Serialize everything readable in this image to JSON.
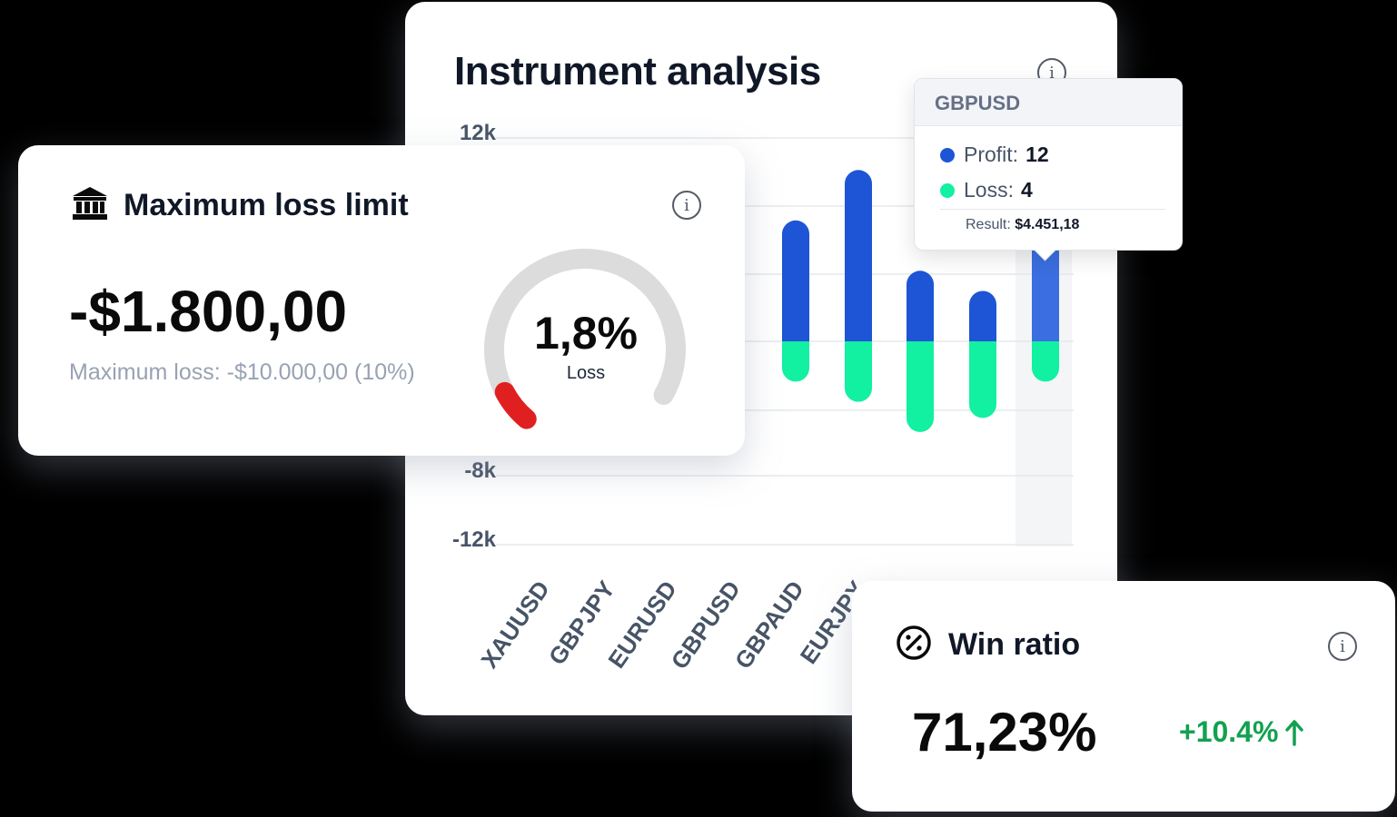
{
  "colors": {
    "profit": "#1d55d6",
    "profit_highlight": "#3b6ee0",
    "loss": "#12f0a2",
    "gauge_fill": "#e02020",
    "gauge_track": "#dcdcdc",
    "positive": "#12a150"
  },
  "instrument_card": {
    "title": "Instrument analysis",
    "info_icon": "info-icon"
  },
  "chart_data": {
    "type": "bar",
    "title": "Instrument analysis",
    "y_tick_labels": [
      "12k",
      "-8k",
      "-12k"
    ],
    "ylim": [
      -12000,
      12000
    ],
    "grid": true,
    "categories": [
      "XAUUSD",
      "GBPJPY",
      "EURUSD",
      "GBPUSD",
      "GBPAUD",
      "EURJPY"
    ],
    "series": [
      {
        "name": "Profit",
        "values": [
          null,
          null,
          6000,
          8500,
          3500,
          2500,
          6000
        ]
      },
      {
        "name": "Loss",
        "values": [
          null,
          null,
          -2000,
          -3000,
          -4500,
          -3800,
          -2000
        ]
      }
    ],
    "highlighted_index": 6
  },
  "tooltip": {
    "title": "GBPUSD",
    "profit_label": "Profit:",
    "profit_value": "12",
    "loss_label": "Loss:",
    "loss_value": "4",
    "result_label": "Result:",
    "result_value": "$4.451,18"
  },
  "loss_card": {
    "icon": "bank-icon",
    "title": "Maximum loss limit",
    "amount": "-$1.800,00",
    "subtitle": "Maximum loss: -$10.000,00 (10%)",
    "gauge_value": "1,8%",
    "gauge_label": "Loss",
    "gauge_fraction": 0.018
  },
  "win_card": {
    "icon": "percent-icon",
    "title": "Win ratio",
    "value": "71,23%",
    "change": "+10.4%",
    "change_icon": "arrow-up-icon"
  }
}
